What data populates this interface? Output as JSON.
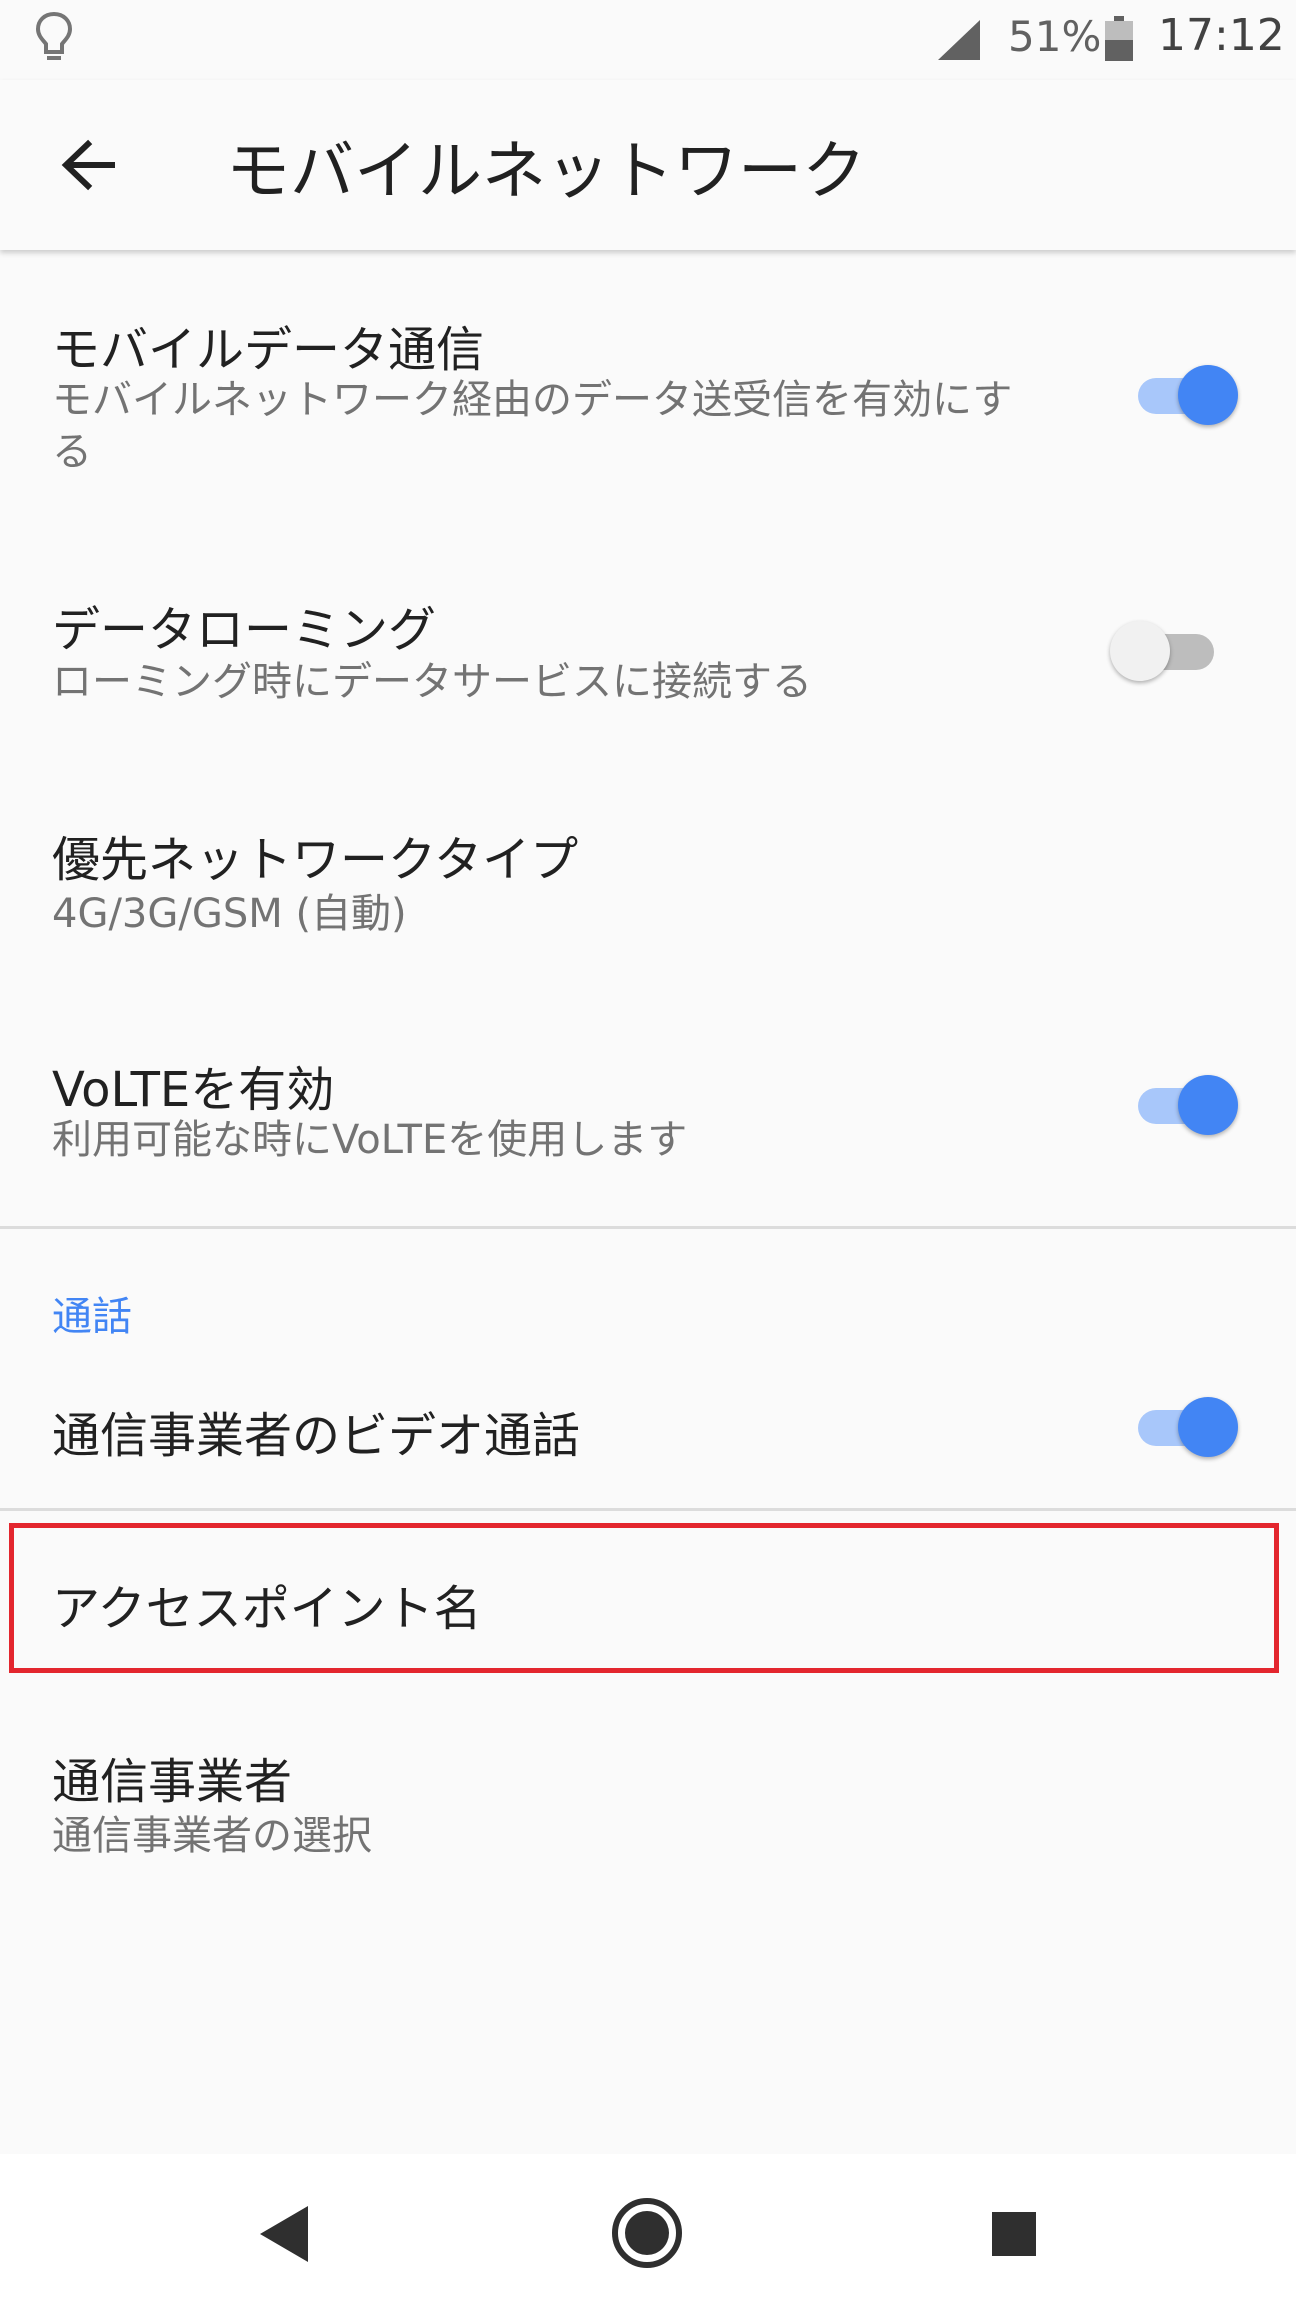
{
  "status_bar": {
    "battery_percent": "51%",
    "time": "17:12",
    "icons": [
      "lightbulb-icon",
      "signal-icon",
      "battery-icon"
    ]
  },
  "app_bar": {
    "title": "モバイルネットワーク",
    "back_icon": "arrow-back-icon"
  },
  "preferences": {
    "mobile_data": {
      "title": "モバイルデータ通信",
      "summary": "モバイルネットワーク経由のデータ送受信を有効にする",
      "checked": true
    },
    "roaming": {
      "title": "データローミング",
      "summary": "ローミング時にデータサービスに接続する",
      "checked": false
    },
    "preferred_network": {
      "title": "優先ネットワークタイプ",
      "summary": "4G/3G/GSM (自動)"
    },
    "volte": {
      "title": "VoLTEを有効",
      "summary": "利用可能な時にVoLTEを使用します",
      "checked": true
    }
  },
  "call_section": {
    "header": "通話",
    "video_call": {
      "title": "通信事業者のビデオ通話",
      "checked": true
    }
  },
  "apn": {
    "title": "アクセスポイント名"
  },
  "carrier": {
    "title": "通信事業者",
    "summary": "通信事業者の選択"
  },
  "colors": {
    "accent": "#4285f4",
    "highlight_border": "#e3262e"
  },
  "nav_bar": {
    "icons": [
      "nav-back-icon",
      "nav-home-icon",
      "nav-recents-icon"
    ]
  }
}
